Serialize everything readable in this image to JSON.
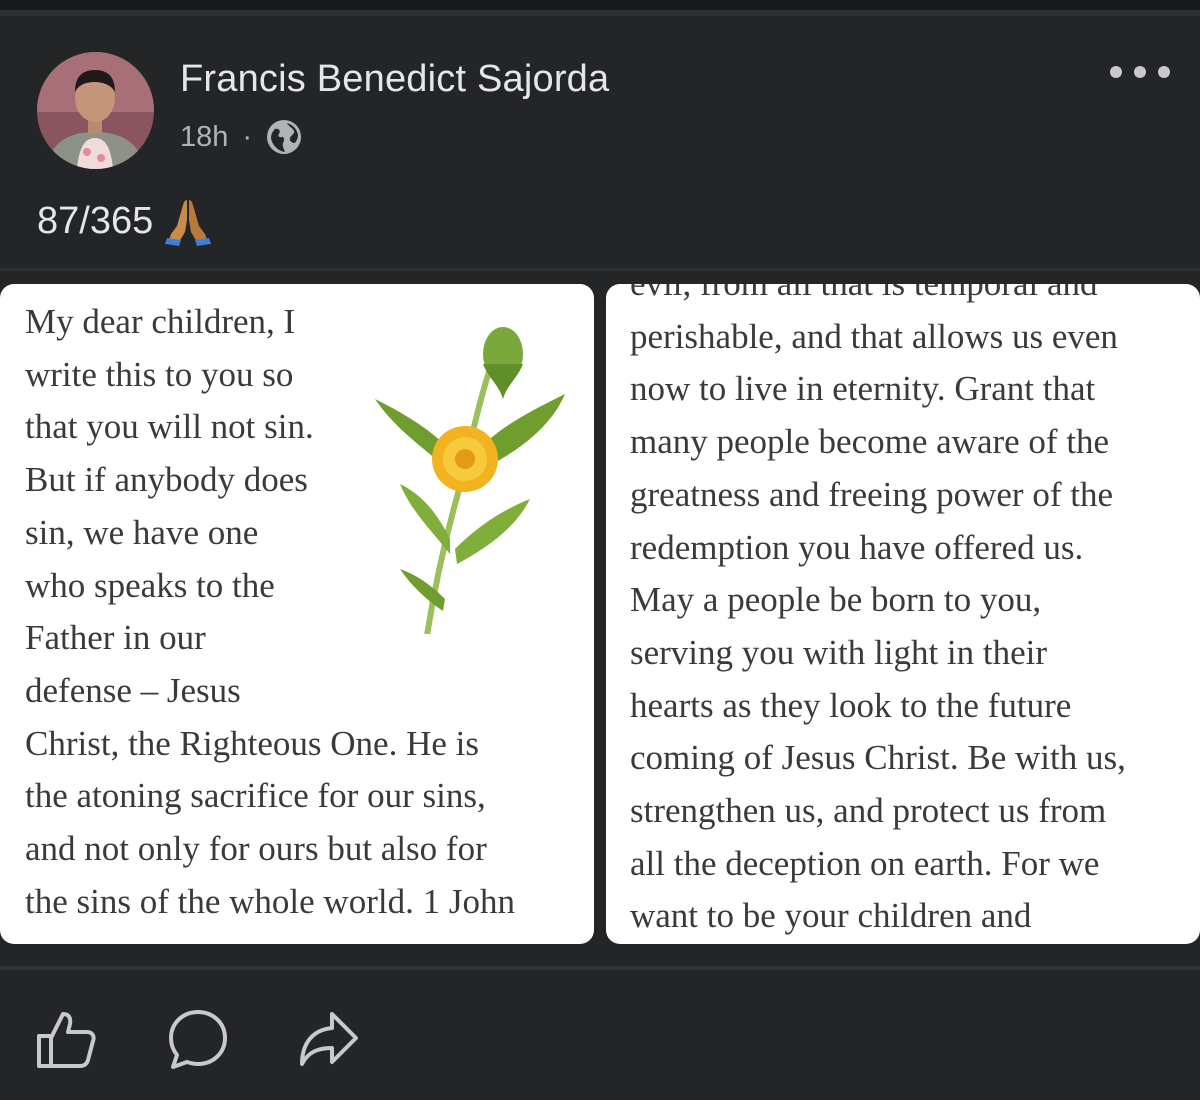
{
  "post": {
    "author": "Francis Benedict Sajorda",
    "time": "18h",
    "separator": "·",
    "audience_icon": "globe-icon",
    "caption": "87/365",
    "caption_emoji": "folded-hands-icon"
  },
  "images": [
    {
      "text": "My dear children, I\nwrite this to you so\nthat you will not sin.\nBut if anybody does\nsin, we have one\nwho speaks to the\nFather in our\ndefense – Jesus\nChrist, the Righteous One. He is\nthe atoning sacrifice for our sins,\nand not only for ours but also for\nthe sins of the whole world. 1 John",
      "illustration": "dandelion-illustration"
    },
    {
      "text": "evil, from all that is temporal and\nperishable, and that allows us even\nnow to live in eternity. Grant that\nmany people become aware of the\ngreatness and freeing power of the\nredemption you have offered us.\nMay a people be born to you,\nserving you with light in their\nhearts as they look to the future\ncoming of Jesus Christ. Be with us,\nstrengthen us, and protect us from\nall the deception on earth. For we\nwant to be your children and"
    }
  ],
  "actions": [
    "like-icon",
    "comment-icon",
    "share-icon"
  ],
  "colors": {
    "background": "#242526",
    "text": "#e4e6eb",
    "muted": "#b0b3b8"
  }
}
